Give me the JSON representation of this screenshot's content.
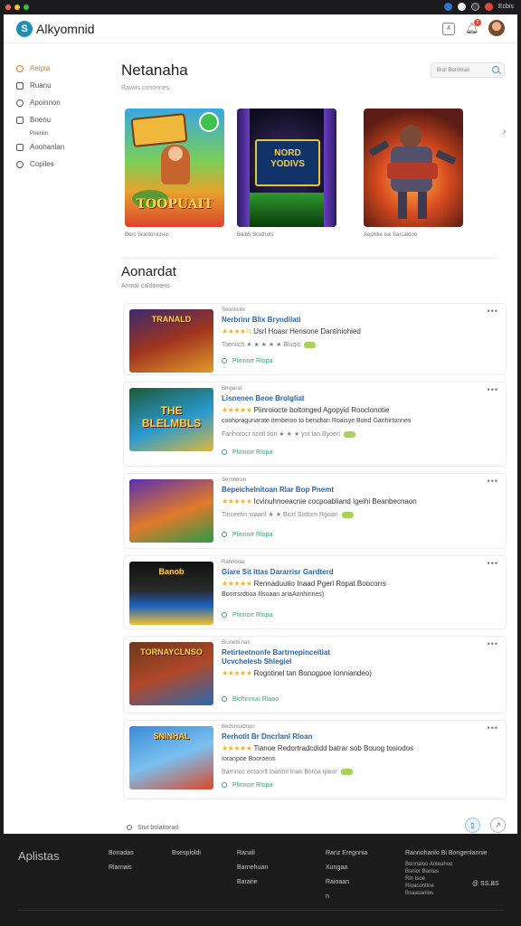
{
  "chrome": {
    "right_label": "Ecbis"
  },
  "header": {
    "app_name": "Alkyomnid",
    "notif_count": "1"
  },
  "sidebar": {
    "items": [
      {
        "label": "Aeipia",
        "active": true,
        "small": false,
        "icon": "grid-icon"
      },
      {
        "label": "Ruanu",
        "active": false,
        "small": false,
        "icon": "chat-icon"
      },
      {
        "label": "Apoinnon",
        "active": false,
        "small": false,
        "icon": "bookmark-icon"
      },
      {
        "label": "Bnenu",
        "active": false,
        "small": false,
        "icon": "clock-icon"
      },
      {
        "label": "Pnenlin",
        "active": false,
        "small": true,
        "icon": "none"
      },
      {
        "label": "Aoohanlan",
        "active": false,
        "small": false,
        "icon": "tag-icon"
      },
      {
        "label": "Copiles",
        "active": false,
        "small": false,
        "icon": "box-icon"
      }
    ]
  },
  "main": {
    "title": "Netanaha",
    "subtitle": "Rawits cononnes",
    "search_placeholder": "Bral Borotitan",
    "featured": [
      {
        "caption": "Borc Sranlonicnes",
        "art_text": "TOOPUAIT"
      },
      {
        "caption": "Baibh Scattrols",
        "art_text": "NORD YODIVS"
      },
      {
        "caption": "Aeprdie Ise Sarcaldoo",
        "art_text": ""
      }
    ],
    "section_title": "Aonardat",
    "section_subtitle": "Anmal caldonens"
  },
  "games": [
    {
      "dev": "Seanlices",
      "title": "Nerbrinr  Blix Bryndilati",
      "stars": "★★★★½",
      "rating_text": "Usrl Hoasr  Hensone Dantiniohied",
      "meta": "Tseniich  ★ ★ ★ ★ ★  Bluqis",
      "extra_line": "",
      "action": "Plinriorr Rlopa",
      "art": "TRANALD"
    },
    {
      "dev": "Bingarar",
      "title": "Lisnenen Beoe Brolgliat",
      "stars": "★★★★★",
      "rating_text": "Piinroiocte boltonged Agopyid Rooclonotie",
      "extra_line": "coohoragunarate itenbeioo to benidtan Roaisye Bond Ganhirtonnes",
      "meta": "Fanhorocr scotl tlon  ★  ★ ★ yot tan  Byoerl",
      "action": "Plinriorr Rlopa",
      "art": "THE BLELMBLS"
    },
    {
      "dev": "Sernnesin",
      "title": "Bepeichelnitoan Rlar Bop Pnemt",
      "stars": "★★★★★",
      "rating_text": "Icvinuhnoeacnie cocpoabliand Igeihi Beanbecnaon",
      "extra_line": "",
      "meta": "Tinceetin  sraanf ★ ★  Bicrt Sottom Rgoan",
      "action": "Plinriorr Rlopa",
      "art": ""
    },
    {
      "dev": "Ranriolaa",
      "title": "Giare Sit Ittas  Dararrisr Gardterd",
      "stars": "★★★★★",
      "rating_text": "Rennaduutio Inaad Pgerl Ropat Boocorrs",
      "extra_line": "Boorrsrdtioa Illsoaan ariaAonhinnes)",
      "meta": "",
      "action": "Plinriorr Rlopa",
      "art": "Banob"
    },
    {
      "dev": "Biunebi nan",
      "title": "Retirteetnonfe Bartrnepinceitiat",
      "extra_title": "Ucvchelesb  Shlegiel",
      "stars": "★★★★★",
      "rating_text": "Rogotinel tan  Bonogpoe Ionniandeo)",
      "extra_line": "",
      "meta": "",
      "action": "Bichinnuu Rlaao",
      "art": "TORNAYCLNSO"
    },
    {
      "dev": "Beosnsabnon",
      "title": "Rerhotit Br  Dncrlanl Rloan",
      "stars": "★★★★★",
      "rating_text": "Tianoe Redortradcdidd batrar sob  Bouog tosiodos",
      "extra_line": "Ioranpoe  Booroeos",
      "meta": "Barnnoc  ectoorlt toantnl tnan  Bsroa Ipeor",
      "action": "Plinriorr Rlopa",
      "art": "SNINHAL"
    }
  ],
  "feedback": {
    "label": "Stut bolaitorad"
  },
  "footer": {
    "logo": "Aplistas",
    "cols": [
      [
        "Bonadas",
        "Rlarnais"
      ],
      [
        "Bsesploldi"
      ],
      [
        "Ranali",
        "Barnehuan",
        "Bararie"
      ],
      [
        "Ranz Eregnnia",
        "Xungaa",
        "Raioaan",
        "n"
      ],
      [
        "Ranriohanlo Bi Bongenlannie"
      ]
    ],
    "small_col": [
      "Bonnaloo Anteahoo",
      "Bsnlor Banlas",
      "Rln Isoe",
      "Rloacontlne",
      "Bsaasanlos"
    ],
    "social": "@  SS.BS"
  }
}
